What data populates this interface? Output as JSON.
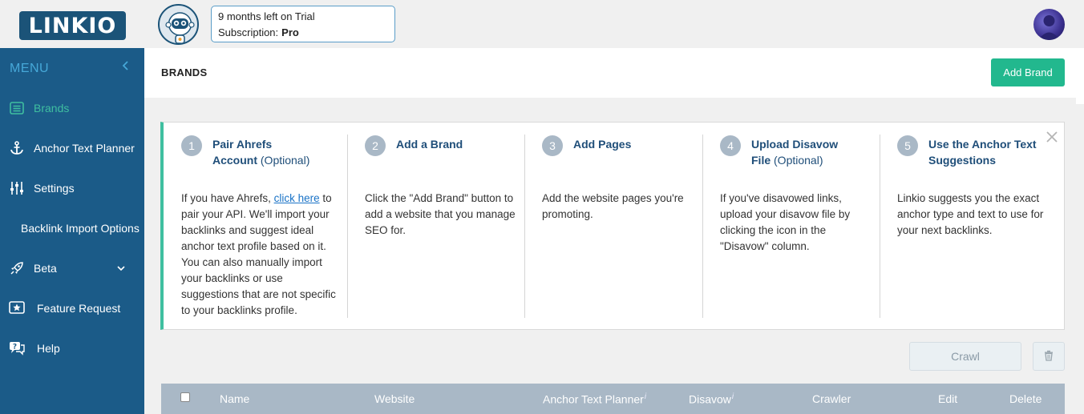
{
  "app": {
    "logo_text": "LINKIO"
  },
  "trial": {
    "line1": "9 months left on Trial",
    "subscription_label": "Subscription:",
    "subscription_value": "Pro"
  },
  "sidebar": {
    "menu_label": "MENU",
    "collapse_icon": "chevron-left-icon",
    "items": [
      {
        "label": "Brands",
        "icon": "list-icon",
        "active": true
      },
      {
        "label": "Anchor Text Planner",
        "icon": "anchor-icon"
      },
      {
        "label": "Settings",
        "icon": "sliders-icon"
      },
      {
        "label": "Backlink Import Options"
      },
      {
        "label": "Beta",
        "icon": "rocket-icon",
        "expand_icon": "chevron-down-icon"
      },
      {
        "label": "Feature Request",
        "icon": "star-icon"
      },
      {
        "label": "Help",
        "icon": "help-chat-icon"
      }
    ]
  },
  "header": {
    "title": "BRANDS",
    "add_brand_label": "Add Brand"
  },
  "steps": [
    {
      "num": "1",
      "title_a": "Pair Ahrefs",
      "title_b": "Account",
      "title_opt": "(Optional)",
      "body_pre": "If you have Ahrefs,",
      "link": "click here",
      "body_post": "to pair your API. We'll import your backlinks and suggest ideal anchor text profile based on it. You can also manually import your backlinks or use suggestions that are not specific to your backlinks profile."
    },
    {
      "num": "2",
      "title_a": "Add a Brand",
      "body": "Click the \"Add Brand\" button to add a website that you manage SEO for."
    },
    {
      "num": "3",
      "title_a": "Add Pages",
      "body": "Add the website pages you're promoting."
    },
    {
      "num": "4",
      "title_a": "Upload Disavow",
      "title_b": "File",
      "title_opt": "(Optional)",
      "body": "If you've disavowed links, upload your disavow file by clicking the icon in the \"Disavow\" column."
    },
    {
      "num": "5",
      "title_a": "Use the Anchor Text",
      "title_b": "Suggestions",
      "body": "Linkio suggests you the exact anchor type and text to use for your next backlinks."
    }
  ],
  "actions": {
    "crawl_label": "Crawl",
    "trash_icon": "trash-icon",
    "close_icon": "close-icon"
  },
  "table": {
    "columns": [
      "Name",
      "Website",
      "Anchor Text Planner",
      "Disavow",
      "Crawler",
      "Edit",
      "Delete"
    ],
    "info_marker": "i"
  },
  "colors": {
    "sidebar": "#1b5b88",
    "accent": "#22b88e",
    "active": "#3fbfa0",
    "table_header": "#a9b8c6",
    "link": "#1f4e79"
  }
}
